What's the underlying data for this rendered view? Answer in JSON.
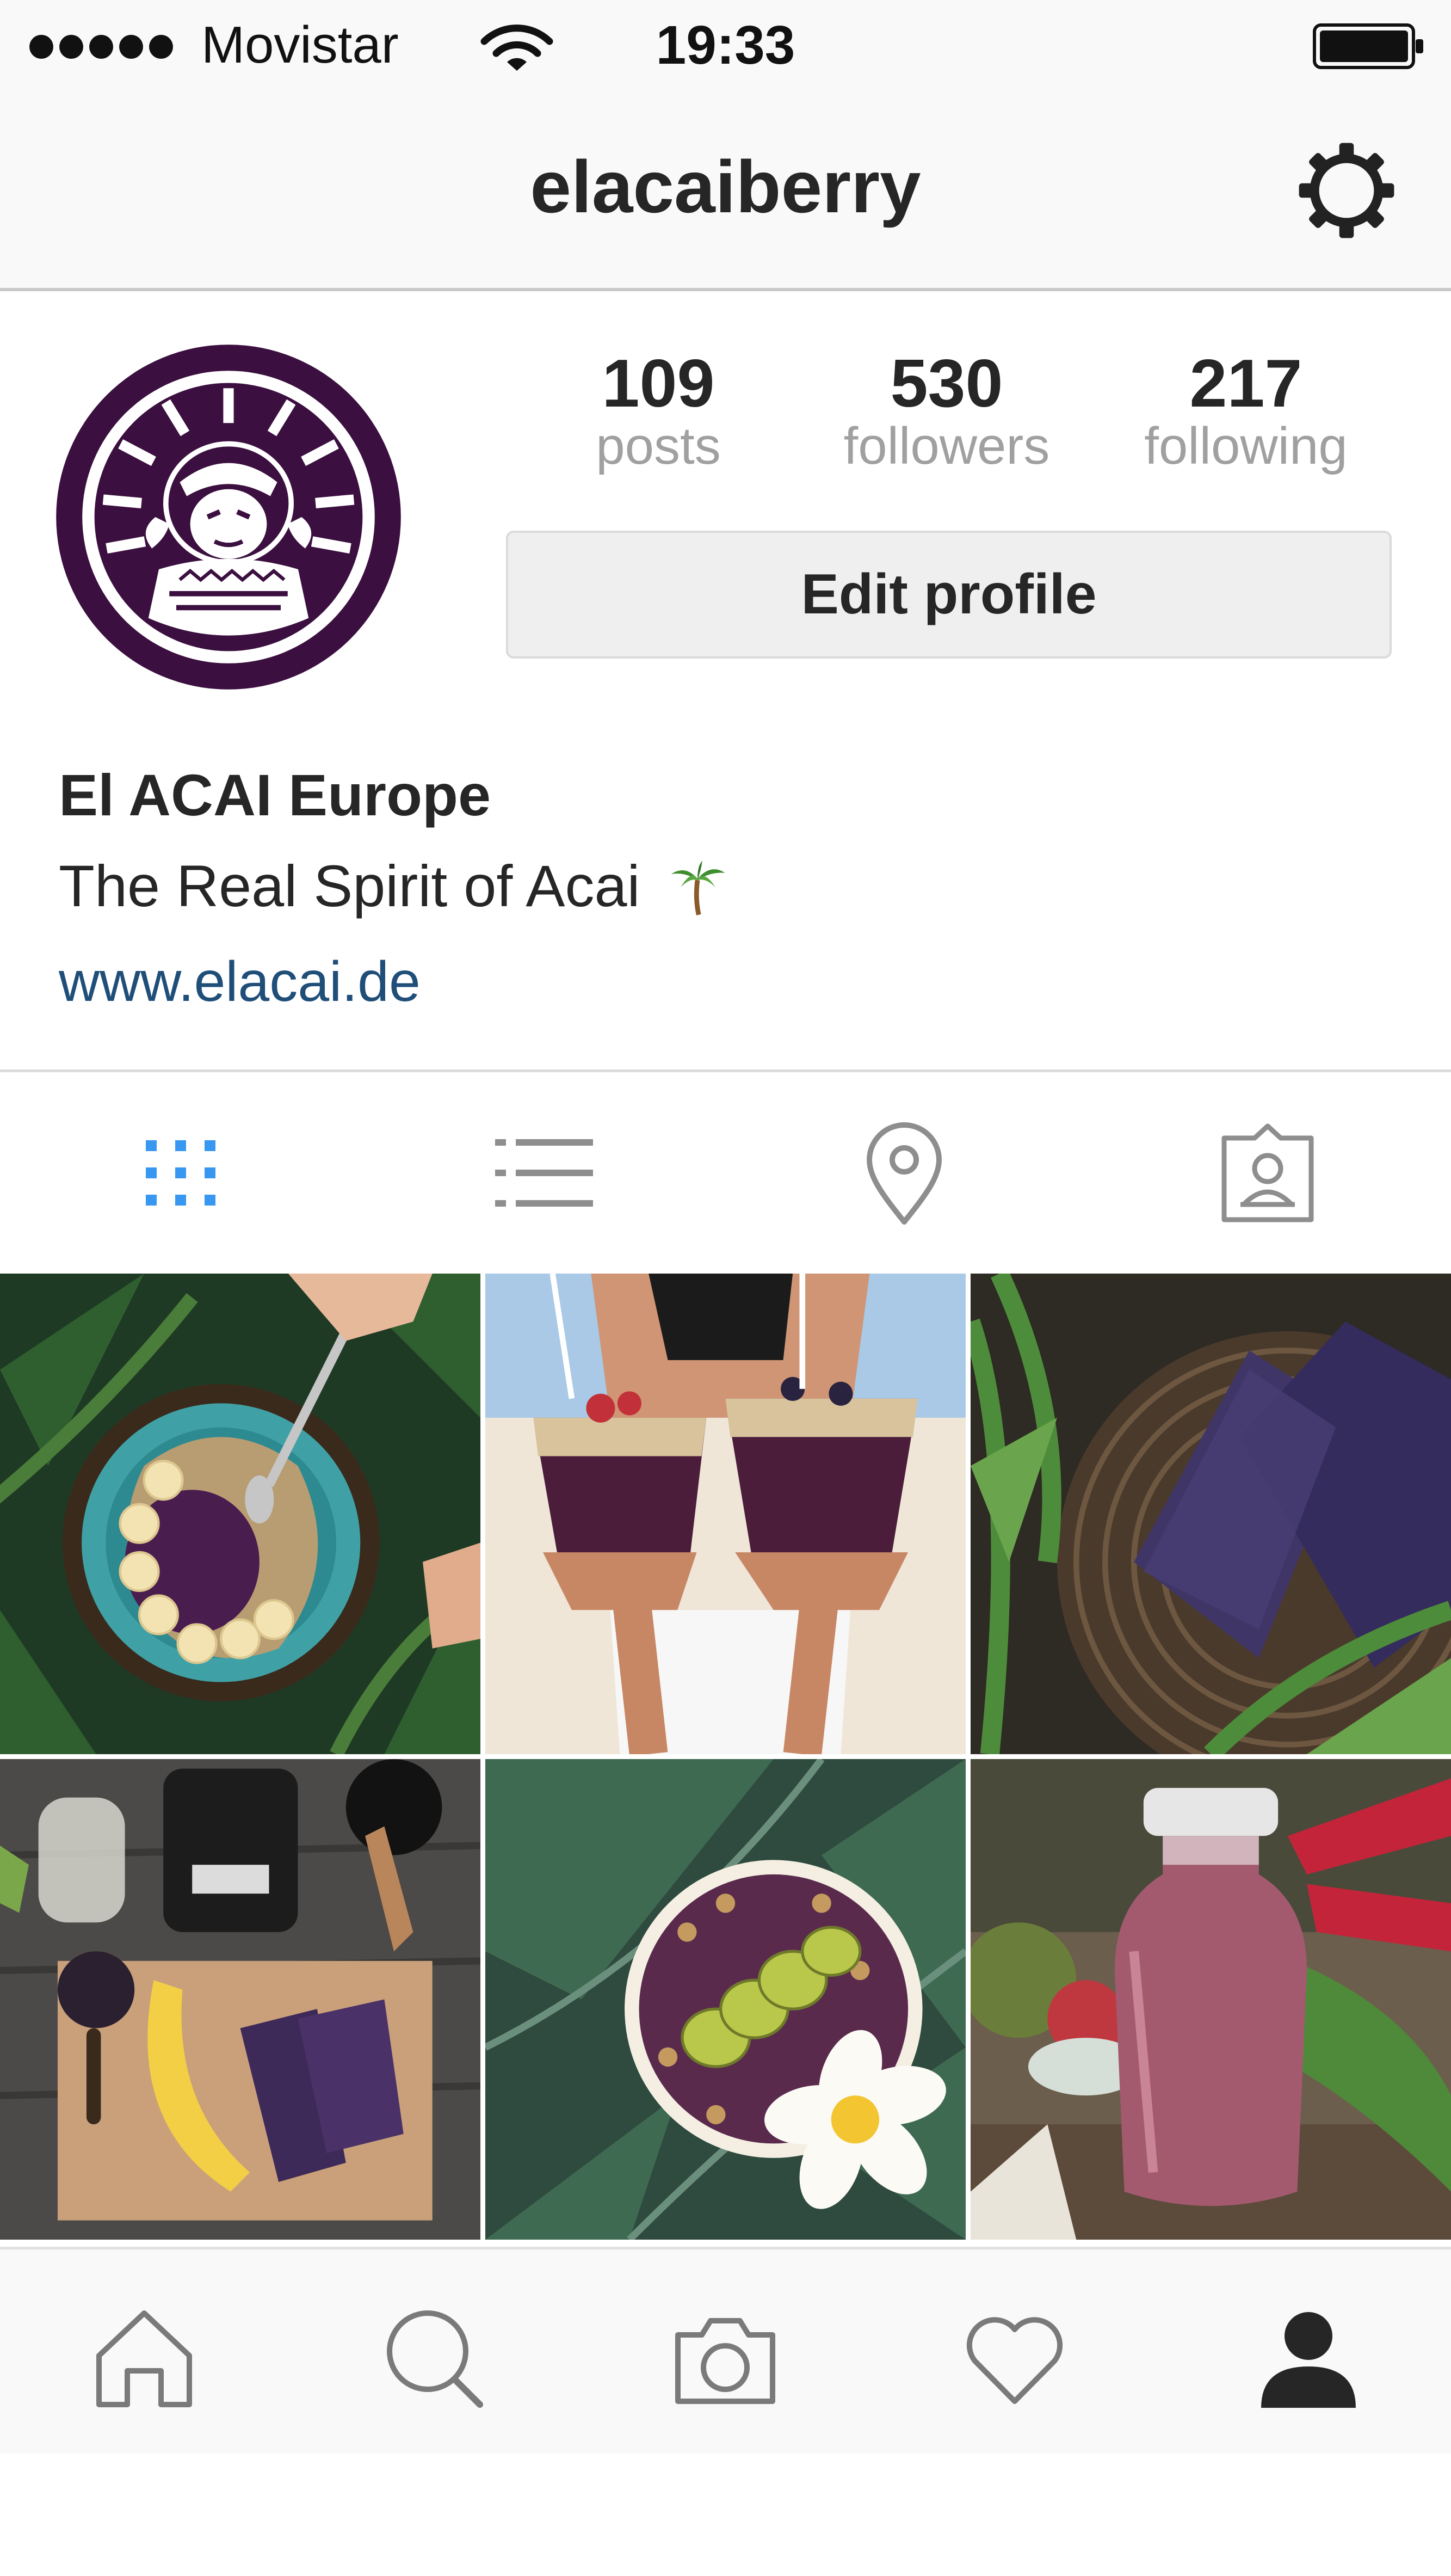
{
  "status_bar": {
    "carrier": "Movistar",
    "time": "19:33",
    "signal_bars": 5
  },
  "nav": {
    "username": "elacaiberry",
    "settings_icon": "gear-icon"
  },
  "profile": {
    "stats": {
      "posts": {
        "value": "109",
        "label": "posts"
      },
      "followers": {
        "value": "530",
        "label": "followers"
      },
      "following": {
        "value": "217",
        "label": "following"
      }
    },
    "edit_profile_label": "Edit profile",
    "full_name": "El ACAI Europe",
    "bio": "The Real Spirit of Acai",
    "bio_emoji": "palm-tree-icon",
    "website": "www.elacai.de",
    "avatar_brand_color": "#3b0f3f"
  },
  "view_tabs": [
    {
      "icon": "grid-icon",
      "active": true
    },
    {
      "icon": "list-icon",
      "active": false
    },
    {
      "icon": "location-pin-icon",
      "active": false
    },
    {
      "icon": "tagged-photos-icon",
      "active": false
    }
  ],
  "posts": [
    {
      "subject": "acai bowl with banana and granola"
    },
    {
      "subject": "two acai cups held at the beach"
    },
    {
      "subject": "frozen acai packs in a basket"
    },
    {
      "subject": "blender, banana and acai packs on a board"
    },
    {
      "subject": "acai bowl with kiwi and plumeria flower"
    },
    {
      "subject": "acai smoothie in a glass bottle"
    }
  ],
  "bottom_tabs": [
    {
      "icon": "home-icon",
      "active": false
    },
    {
      "icon": "search-icon",
      "active": false
    },
    {
      "icon": "camera-icon",
      "active": false
    },
    {
      "icon": "heart-icon",
      "active": false
    },
    {
      "icon": "profile-icon",
      "active": true
    }
  ],
  "colors": {
    "active_tab": "#3897f0",
    "inactive_icon": "#8e8e8e",
    "link": "#1f4e79",
    "acai_purple": "#4a1d4f"
  }
}
